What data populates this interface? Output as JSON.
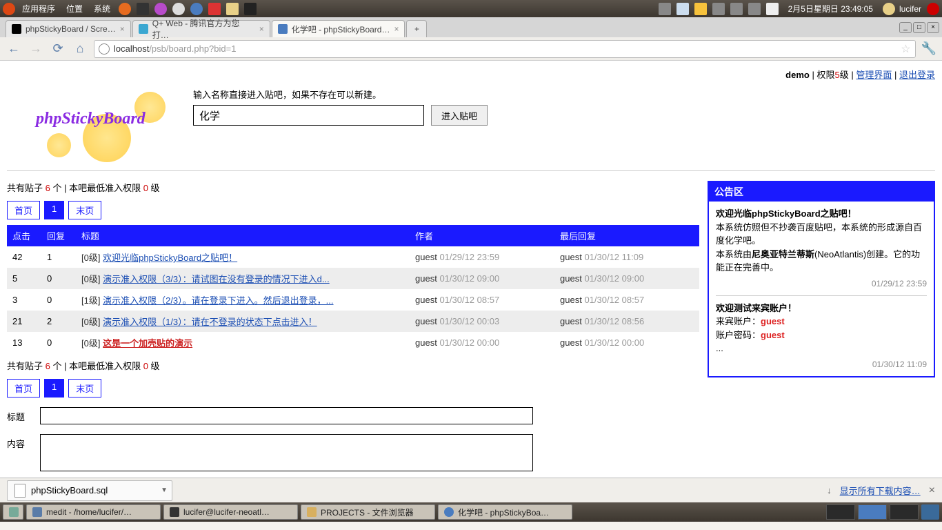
{
  "os": {
    "menus": [
      "应用程序",
      "位置",
      "系统"
    ],
    "clock": "2月5日星期日 23:49:05",
    "user": "lucifer"
  },
  "browser": {
    "tabs": [
      {
        "title": "phpStickyBoard / Scre…",
        "favicon": "sf"
      },
      {
        "title": "Q+ Web - 腾讯官方为您打…",
        "favicon": "q"
      },
      {
        "title": "化学吧 - phpStickyBoard…",
        "favicon": "default",
        "active": true
      }
    ],
    "newtab": "+",
    "nav": {
      "back": "←",
      "forward": "→",
      "reload": "⟳",
      "home": "⌂"
    },
    "url_host": "localhost",
    "url_path": "/psb/board.php?bid=1",
    "wrench": "🔧"
  },
  "userbar": {
    "name": "demo",
    "perm_prefix": "权限",
    "perm_num": "5",
    "perm_suffix": "级",
    "admin": "管理界面",
    "logout": "退出登录"
  },
  "logo": "phpStickyBoard",
  "search": {
    "hint": "输入名称直接进入贴吧，如果不存在可以新建。",
    "value": "化学",
    "button": "进入贴吧"
  },
  "stats": {
    "prefix": "共有贴子 ",
    "count": "6",
    "mid": " 个 | 本吧最低准入权限 ",
    "level": "0",
    "suffix": " 级"
  },
  "pager": {
    "first": "首页",
    "current": "1",
    "last": "末页"
  },
  "table": {
    "headers": {
      "hits": "点击",
      "replies": "回复",
      "title": "标题",
      "author": "作者",
      "last": "最后回复"
    },
    "rows": [
      {
        "hits": "42",
        "replies": "1",
        "level": "[0级]",
        "title": "欢迎光临phpStickyBoard之贴吧！",
        "author": "guest",
        "adate": "01/29/12 23:59",
        "ruser": "guest",
        "rdate": "01/30/12 11:09",
        "red": false
      },
      {
        "hits": "5",
        "replies": "0",
        "level": "[0级]",
        "title": "演示准入权限（3/3）：请试图在没有登录的情况下进入d...",
        "author": "guest",
        "adate": "01/30/12 09:00",
        "ruser": "guest",
        "rdate": "01/30/12 09:00",
        "red": false
      },
      {
        "hits": "3",
        "replies": "0",
        "level": "[1级]",
        "title": "演示准入权限（2/3）。请在登录下进入。然后退出登录，...",
        "author": "guest",
        "adate": "01/30/12 08:57",
        "ruser": "guest",
        "rdate": "01/30/12 08:57",
        "red": false
      },
      {
        "hits": "21",
        "replies": "2",
        "level": "[0级]",
        "title": "演示准入权限（1/3）：请在不登录的状态下点击进入！",
        "author": "guest",
        "adate": "01/30/12 00:03",
        "ruser": "guest",
        "rdate": "01/30/12 08:56",
        "red": false
      },
      {
        "hits": "13",
        "replies": "0",
        "level": "[0级]",
        "title": "这是一个加壳贴的演示",
        "author": "guest",
        "adate": "01/30/12 00:00",
        "ruser": "guest",
        "rdate": "01/30/12 00:00",
        "red": true
      }
    ]
  },
  "notice": {
    "header": "公告区",
    "n1_title": "欢迎光临phpStickyBoard之贴吧！",
    "n1_l1": "本系统仿照但不抄袭百度贴吧，本系统的形成源自百度化学吧。",
    "n1_l2a": "本系统由",
    "n1_l2b": "尼奥亚特兰蒂斯",
    "n1_l2c": "(NeoAtlantis)创建。它的功能正在完善中。",
    "n1_ts": "01/29/12 23:59",
    "n2_title": "欢迎测试来宾账户！",
    "n2_l1a": "来宾账户：",
    "n2_l1b": "guest",
    "n2_l2a": "账户密码：",
    "n2_l2b": "guest",
    "n2_l3": "...",
    "n2_ts": "01/30/12 11:09"
  },
  "form": {
    "title_label": "标题",
    "content_label": "内容"
  },
  "download": {
    "file": "phpStickyBoard.sql",
    "showall": "显示所有下载内容…"
  },
  "taskbar": {
    "items": [
      "medit - /home/lucifer/…",
      "lucifer@lucifer-neoatl…",
      "PROJECTS - 文件浏览器",
      "化学吧 - phpStickyBoa…"
    ]
  }
}
